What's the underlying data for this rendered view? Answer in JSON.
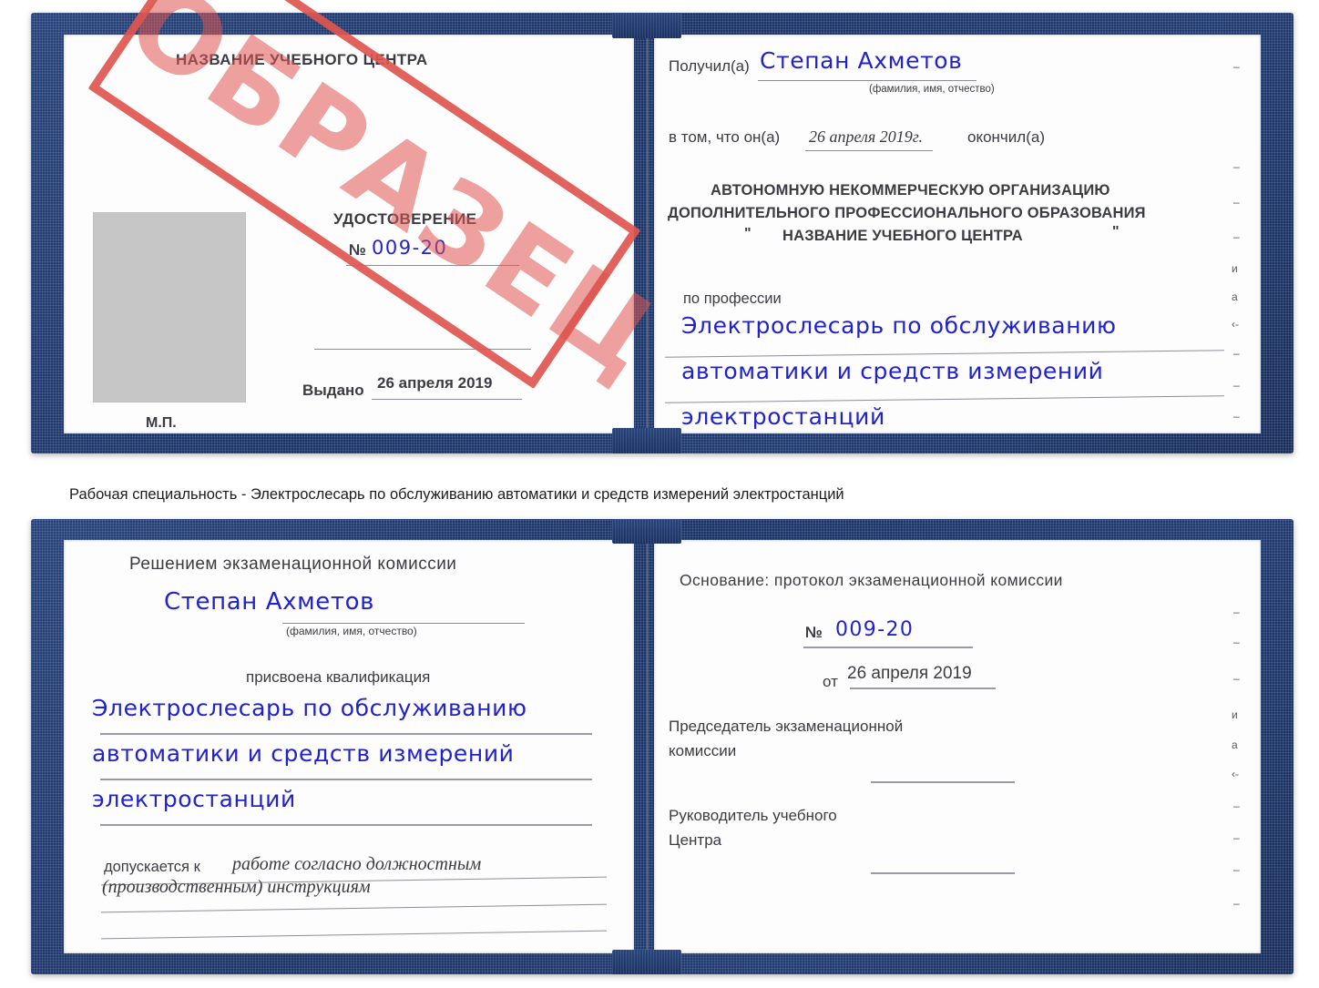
{
  "caption": {
    "text": "Рабочая специальность - Электрослесарь по обслуживанию автоматики и средств измерений электростанций"
  },
  "certificate_top": {
    "left_page": {
      "center_name": "НАЗВАНИЕ УЧЕБНОГО ЦЕНТРА",
      "doc_title": "УДОСТОВЕРЕНИЕ",
      "number_label": "№",
      "number_value": "009-20",
      "issued_label": "Выдано",
      "issued_value": "26 апреля 2019",
      "seal_label": "М.П.",
      "photo_placeholder": "photo-placeholder"
    },
    "right_page": {
      "received_label": "Получил(а)",
      "received_value": "Степан Ахметов",
      "fio_hint": "(фамилия, имя, отчество)",
      "in_that_label": "в том, что он(а)",
      "completion_date": "26 апреля 2019г.",
      "finished_label": "окончил(а)",
      "org_line1": "АВТОНОМНУЮ НЕКОММЕРЧЕСКУЮ ОРГАНИЗАЦИЮ",
      "org_line2": "ДОПОЛНИТЕЛЬНОГО ПРОФЕССИОНАЛЬНОГО ОБРАЗОВАНИЯ",
      "org_quote_open": "\"",
      "org_line3": "НАЗВАНИЕ УЧЕБНОГО ЦЕНТРА",
      "org_quote_close": "\"",
      "profession_label": "по профессии",
      "profession_line1": "Электрослесарь по обслуживанию",
      "profession_line2": "автоматики и средств измерений",
      "profession_line3": "электростанций",
      "edge_fragments": [
        "–",
        "–",
        "–",
        "–",
        "и",
        "а",
        "‹-",
        "–",
        "–",
        "–"
      ]
    },
    "stamp": {
      "text": "ОБРАЗЕЦ",
      "color": "#e0554f"
    }
  },
  "certificate_bottom": {
    "left_page": {
      "heading": "Решением экзаменационной комиссии",
      "name_value": "Степан Ахметов",
      "fio_hint": "(фамилия, имя, отчество)",
      "qualification_label": "присвоена квалификация",
      "qual_line1": "Электрослесарь по обслуживанию",
      "qual_line2": "автоматики и средств измерений",
      "qual_line3": "электростанций",
      "allowed_label": "допускается к",
      "allowed_value1": "работе согласно должностным",
      "allowed_value2": "(производственным) инструкциям"
    },
    "right_page": {
      "basis_label": "Основание: протокол экзаменационной комиссии",
      "number_label": "№",
      "number_value": "009-20",
      "date_label": "от",
      "date_value": "26 апреля 2019",
      "chairman_line1": "Председатель экзаменационной",
      "chairman_line2": "комиссии",
      "head_line1": "Руководитель учебного",
      "head_line2": "Центра",
      "edge_fragments": [
        "–",
        "–",
        "–",
        "и",
        "а",
        "‹-",
        "–",
        "–",
        "–",
        "–"
      ]
    }
  },
  "theme": {
    "cover_blue": "#24427c",
    "ink_blue": "#2222cc",
    "stamp_red": "#e0554f",
    "paper": "#fdfdfd",
    "rule_gray": "#8d8d96",
    "photo_gray": "#c6c6c6"
  }
}
